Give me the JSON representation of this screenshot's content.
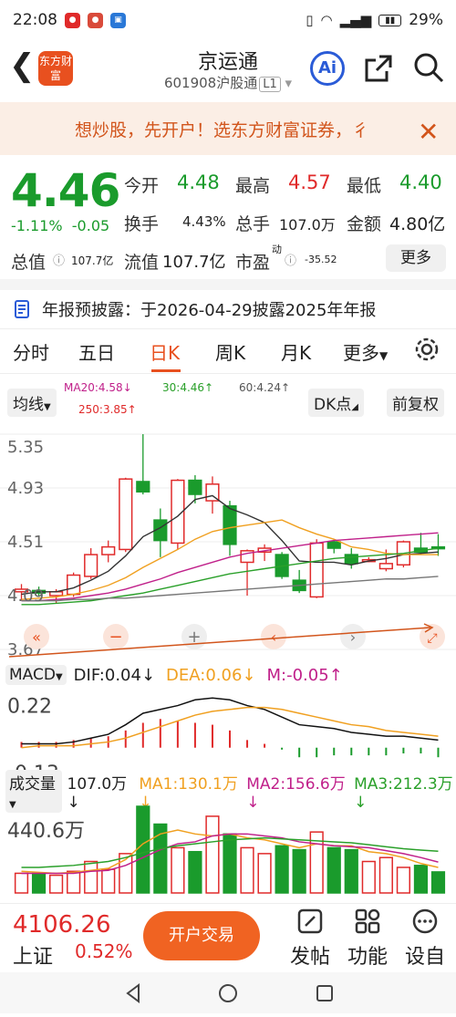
{
  "status_bar": {
    "time": "22:08",
    "battery": "29%"
  },
  "header": {
    "logo_text": "东方财富",
    "title": "京运通",
    "code": "601908",
    "market_tag": "沪股通",
    "level_tag": "L1",
    "ai_label": "Ai"
  },
  "banner": {
    "text": "想炒股，先开户！选东方财富证券，彳"
  },
  "quote": {
    "price": "4.46",
    "change_pct": "-1.11%",
    "change": "-0.05",
    "open_label": "今开",
    "open": "4.48",
    "high_label": "最高",
    "high": "4.57",
    "low_label": "最低",
    "low": "4.40",
    "turnover_label": "换手",
    "turnover": "4.43%",
    "volume_label": "总手",
    "volume": "107.0万",
    "amount_label": "金额",
    "amount": "4.80亿",
    "mcap_label": "总值",
    "mcap": "107.7亿",
    "float_label": "流值",
    "float": "107.7亿",
    "pe_label": "市盈",
    "pe_sup": "动",
    "pe": "-35.52",
    "more_label": "更多"
  },
  "notice": {
    "text": "年报预披露：于2026-04-29披露2025年年报"
  },
  "tabs": [
    {
      "label": "分时"
    },
    {
      "label": "五日"
    },
    {
      "label": "日K"
    },
    {
      "label": "周K"
    },
    {
      "label": "月K"
    },
    {
      "label": "更多"
    }
  ],
  "kline_options": {
    "ma_select": "均线",
    "ma20": "MA20:4.58↓",
    "ma30": "30:4.46↑",
    "ma60": "60:4.24↑",
    "ma250": "250:3.85↑",
    "dk_label": "DK点",
    "adjust_label": "前复权"
  },
  "colors": {
    "up": "#e02a2a",
    "down": "#1a9b2c",
    "accent": "#e8501f",
    "ma5": "#333333",
    "ma10": "#f0a020",
    "ma20": "#c0208a",
    "ma30": "#2aa02a",
    "ma60": "#777777"
  },
  "chart_data": [
    {
      "type": "candlestick",
      "y_ticks": [
        "5.35",
        "4.93",
        "4.51",
        "4.09",
        "3.67"
      ],
      "ylim": [
        3.67,
        5.35
      ],
      "candles": [
        {
          "o": 4.12,
          "h": 4.18,
          "l": 4.05,
          "c": 4.14
        },
        {
          "o": 4.13,
          "h": 4.16,
          "l": 4.08,
          "c": 4.11
        },
        {
          "o": 4.09,
          "h": 4.14,
          "l": 4.03,
          "c": 4.12
        },
        {
          "o": 4.1,
          "h": 4.27,
          "l": 4.08,
          "c": 4.25
        },
        {
          "o": 4.24,
          "h": 4.46,
          "l": 4.22,
          "c": 4.41
        },
        {
          "o": 4.41,
          "h": 4.52,
          "l": 4.35,
          "c": 4.47
        },
        {
          "o": 4.45,
          "h": 5.01,
          "l": 4.43,
          "c": 5.0
        },
        {
          "o": 4.98,
          "h": 5.35,
          "l": 4.88,
          "c": 4.9
        },
        {
          "o": 4.68,
          "h": 4.77,
          "l": 4.39,
          "c": 4.52
        },
        {
          "o": 4.5,
          "h": 5.0,
          "l": 4.45,
          "c": 4.99
        },
        {
          "o": 4.99,
          "h": 5.03,
          "l": 4.81,
          "c": 4.88
        },
        {
          "o": 4.83,
          "h": 5.02,
          "l": 4.73,
          "c": 4.96
        },
        {
          "o": 4.79,
          "h": 4.83,
          "l": 4.4,
          "c": 4.49
        },
        {
          "o": 4.35,
          "h": 4.45,
          "l": 4.09,
          "c": 4.44
        },
        {
          "o": 4.43,
          "h": 4.49,
          "l": 4.36,
          "c": 4.46
        },
        {
          "o": 4.41,
          "h": 4.43,
          "l": 4.22,
          "c": 4.24
        },
        {
          "o": 4.21,
          "h": 4.29,
          "l": 4.11,
          "c": 4.13
        },
        {
          "o": 4.08,
          "h": 4.53,
          "l": 4.07,
          "c": 4.5
        },
        {
          "o": 4.51,
          "h": 4.53,
          "l": 4.42,
          "c": 4.46
        },
        {
          "o": 4.41,
          "h": 4.46,
          "l": 4.3,
          "c": 4.34
        },
        {
          "o": 4.37,
          "h": 4.39,
          "l": 4.35,
          "c": 4.37
        },
        {
          "o": 4.3,
          "h": 4.45,
          "l": 4.28,
          "c": 4.34
        },
        {
          "o": 4.33,
          "h": 4.52,
          "l": 4.31,
          "c": 4.51
        },
        {
          "o": 4.46,
          "h": 4.58,
          "l": 4.41,
          "c": 4.43
        },
        {
          "o": 4.47,
          "h": 4.57,
          "l": 4.4,
          "c": 4.46
        }
      ],
      "ma_lines": {
        "ma5": [
          4.1,
          4.12,
          4.12,
          4.15,
          4.21,
          4.28,
          4.4,
          4.55,
          4.62,
          4.71,
          4.84,
          4.87,
          4.77,
          4.72,
          4.66,
          4.52,
          4.36,
          4.35,
          4.35,
          4.33,
          4.36,
          4.38,
          4.41,
          4.42,
          4.43
        ],
        "ma10": [
          4.06,
          4.07,
          4.08,
          4.1,
          4.13,
          4.17,
          4.23,
          4.31,
          4.38,
          4.45,
          4.53,
          4.59,
          4.62,
          4.64,
          4.66,
          4.68,
          4.62,
          4.57,
          4.53,
          4.47,
          4.45,
          4.42,
          4.41,
          4.41,
          4.41
        ],
        "ma20": [
          4.05,
          4.05,
          4.06,
          4.07,
          4.09,
          4.11,
          4.14,
          4.18,
          4.22,
          4.27,
          4.31,
          4.35,
          4.39,
          4.42,
          4.44,
          4.46,
          4.48,
          4.5,
          4.52,
          4.53,
          4.54,
          4.55,
          4.56,
          4.57,
          4.58
        ],
        "ma30": [
          4.02,
          4.02,
          4.03,
          4.04,
          4.05,
          4.07,
          4.09,
          4.11,
          4.14,
          4.17,
          4.2,
          4.23,
          4.26,
          4.28,
          4.3,
          4.32,
          4.34,
          4.36,
          4.38,
          4.39,
          4.4,
          4.41,
          4.42,
          4.44,
          4.46
        ],
        "ma60": [
          4.05,
          4.05,
          4.05,
          4.06,
          4.06,
          4.07,
          4.07,
          4.08,
          4.09,
          4.1,
          4.11,
          4.12,
          4.13,
          4.14,
          4.15,
          4.16,
          4.17,
          4.18,
          4.19,
          4.2,
          4.21,
          4.22,
          4.22,
          4.23,
          4.24
        ]
      }
    },
    {
      "type": "bar",
      "label": "MACD",
      "dif_label": "DIF:0.04↓",
      "dea_label": "DEA:0.06↓",
      "m_label": "M:-0.05↑",
      "y_ticks": [
        "0.22",
        "-0.13"
      ],
      "ylim": [
        -0.13,
        0.28
      ],
      "hist": [
        0.03,
        0.03,
        0.03,
        0.04,
        0.05,
        0.06,
        0.09,
        0.13,
        0.15,
        0.14,
        0.13,
        0.12,
        0.09,
        0.04,
        0.02,
        -0.01,
        -0.05,
        -0.05,
        -0.04,
        -0.04,
        -0.04,
        -0.04,
        -0.03,
        -0.03,
        -0.05
      ],
      "dif": [
        0.02,
        0.02,
        0.02,
        0.03,
        0.05,
        0.07,
        0.12,
        0.18,
        0.2,
        0.22,
        0.25,
        0.26,
        0.25,
        0.22,
        0.2,
        0.16,
        0.12,
        0.11,
        0.1,
        0.08,
        0.07,
        0.06,
        0.06,
        0.05,
        0.04
      ],
      "dea": [
        0.0,
        0.01,
        0.01,
        0.01,
        0.02,
        0.03,
        0.05,
        0.08,
        0.11,
        0.14,
        0.17,
        0.19,
        0.2,
        0.21,
        0.21,
        0.2,
        0.18,
        0.16,
        0.14,
        0.12,
        0.11,
        0.09,
        0.08,
        0.07,
        0.06
      ]
    },
    {
      "type": "bar",
      "label": "成交量",
      "vol_label": "107.0万↓",
      "ma1_label": "MA1:130.1万↓",
      "ma2_label": "MA2:156.6万↓",
      "ma3_label": "MA3:212.3万↓",
      "y_ticks": [
        "440.6万"
      ],
      "ylim": [
        0,
        440.6
      ],
      "volumes": [
        100,
        100,
        90,
        110,
        160,
        120,
        200,
        480,
        350,
        230,
        210,
        390,
        300,
        230,
        200,
        240,
        220,
        310,
        230,
        220,
        160,
        180,
        130,
        140,
        107
      ],
      "ma1": [
        110,
        105,
        100,
        105,
        115,
        125,
        170,
        250,
        300,
        320,
        300,
        290,
        300,
        280,
        270,
        250,
        230,
        250,
        240,
        240,
        210,
        200,
        180,
        150,
        130
      ],
      "ma2": [
        100,
        100,
        100,
        100,
        110,
        115,
        140,
        180,
        220,
        250,
        260,
        290,
        300,
        300,
        290,
        280,
        260,
        250,
        240,
        235,
        230,
        215,
        200,
        180,
        157
      ],
      "ma3": [
        130,
        130,
        135,
        140,
        150,
        160,
        180,
        205,
        225,
        240,
        250,
        260,
        270,
        275,
        280,
        275,
        270,
        265,
        260,
        255,
        245,
        235,
        225,
        218,
        212
      ]
    }
  ],
  "bottom_bar": {
    "index_value": "4106.26",
    "index_name": "上证",
    "index_change": "0.52%",
    "trade_label": "开户交易",
    "post_label": "发帖",
    "func_label": "功能",
    "settings_label": "设自"
  }
}
